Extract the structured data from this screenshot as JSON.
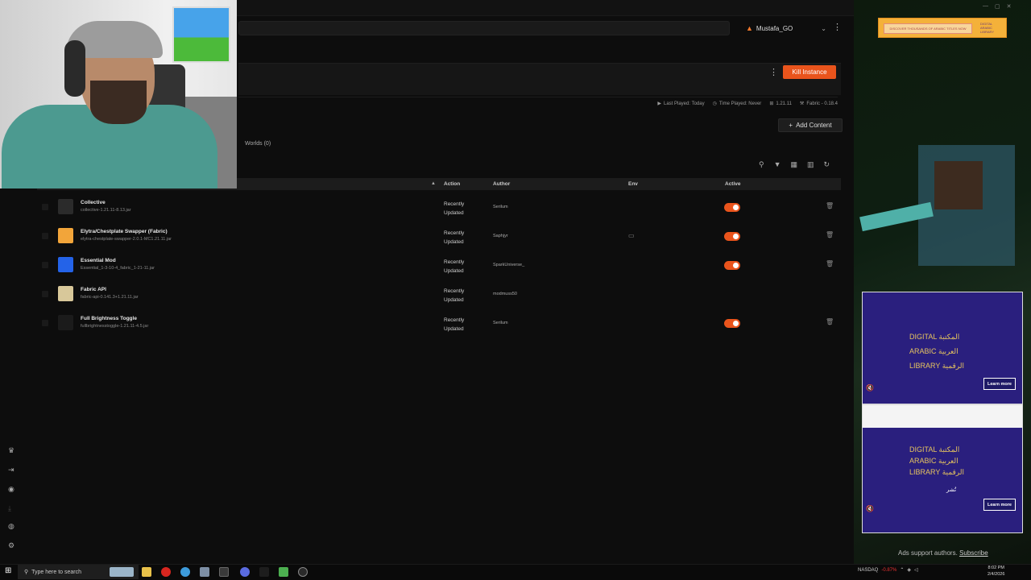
{
  "header": {
    "account_name": "Mustafa_GO",
    "kill_button": "Kill Instance"
  },
  "instance_stats": {
    "last_played": "Last Played: Today",
    "time_played": "Time Played: Never",
    "version": "1.21.11",
    "loader": "Fabric - 0.18.4"
  },
  "content": {
    "add_content_label": "Add Content",
    "worlds_tab": "Worlds (0)",
    "columns": {
      "action": "Action",
      "author": "Author",
      "env": "Env",
      "active": "Active"
    },
    "mods": [
      {
        "name": "Collective",
        "file": "collective-1.21.11-8.13.jar",
        "action": "Recently Updated",
        "author": "Serilum",
        "active": true,
        "env_icon": "",
        "icon_color": "#2b2b2b"
      },
      {
        "name": "Elytra/Chestplate Swapper (Fabric)",
        "file": "elytra-chestplate-swapper-2.0.1-MC1.21.11.jar",
        "action": "Recently Updated",
        "author": "Saphjyr",
        "active": true,
        "env_icon": "monitor-icon",
        "icon_color": "#f2a53a"
      },
      {
        "name": "Essential Mod",
        "file": "Essential_1-3-10-4_fabric_1-21-11.jar",
        "action": "Recently Updated",
        "author": "SparkUniverse_",
        "active": true,
        "env_icon": "",
        "icon_color": "#2463e8"
      },
      {
        "name": "Fabric API",
        "file": "fabric-api-0.141.3+1.21.11.jar",
        "action": "Recently Updated",
        "author": "modmuss50",
        "active": false,
        "env_icon": "",
        "icon_color": "#d8c89a"
      },
      {
        "name": "Full Brightness Toggle",
        "file": "fullbrightnesstoggle-1.21.11-4.5.jar",
        "action": "Recently Updated",
        "author": "Serilum",
        "active": true,
        "env_icon": "",
        "icon_color": "#1b1b1b"
      }
    ]
  },
  "ads": {
    "top_banner_text": "DISCOVER THOUSANDS OF ARABIC TITLES NOW",
    "top_banner_logo": "DIGITAL ARABIC LIBRARY",
    "ad1_line1": "DIGITAL المكتبة",
    "ad1_line2": "ARABIC العربية",
    "ad1_line3": "LIBRARY الرقمية",
    "learn_more": "Learn more",
    "ad2_line1": "DIGITAL المكتبة",
    "ad2_line2": "ARABIC العربية",
    "ad2_line3": "LIBRARY الرقمية",
    "ad2_sub": "تُشر",
    "support_text": "Ads support authors.",
    "subscribe": "Subscribe"
  },
  "taskbar": {
    "search_placeholder": "Type here to search",
    "ticker_name": "NASDAQ",
    "ticker_change": "-0.87%",
    "time": "8:02 PM",
    "date": "2/4/2026"
  },
  "colors": {
    "accent": "#e9541c",
    "ad_bg": "#2a1f7e",
    "ad_gold": "#e5c35f"
  }
}
